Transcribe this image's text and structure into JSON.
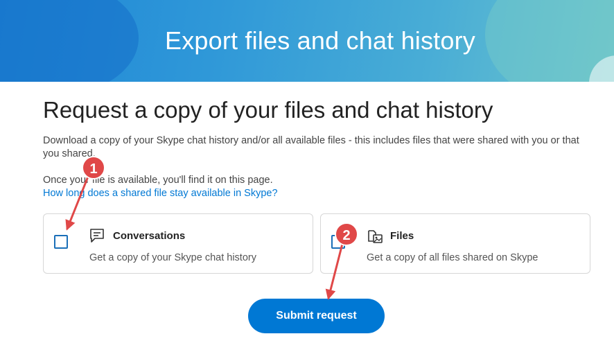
{
  "banner": {
    "title": "Export files and chat history"
  },
  "main": {
    "heading": "Request a copy of your files and chat history",
    "description": "Download a copy of your Skype chat history and/or all available files - this includes files that were shared with you or that you shared.",
    "availability_note": "Once your file is available, you'll find it on this page.",
    "help_link": "How long does a shared file stay available in Skype?"
  },
  "options": [
    {
      "icon": "chat-icon",
      "title": "Conversations",
      "subtitle": "Get a copy of your Skype chat history",
      "checked": false
    },
    {
      "icon": "files-icon",
      "title": "Files",
      "subtitle": "Get a copy of all files shared on Skype",
      "checked": false
    }
  ],
  "submit": {
    "label": "Submit request"
  },
  "annotations": [
    {
      "number": "1"
    },
    {
      "number": "2"
    }
  ],
  "colors": {
    "accent": "#0078d4",
    "annotation": "#e04848"
  }
}
